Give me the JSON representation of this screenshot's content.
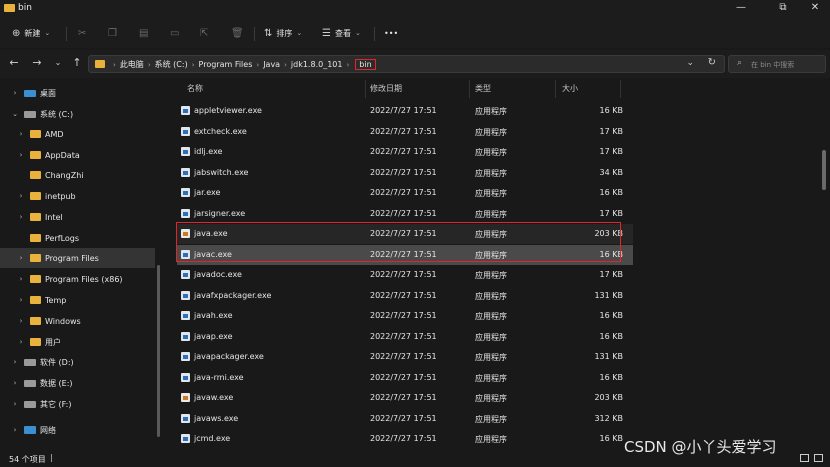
{
  "window": {
    "title": "bin"
  },
  "toolbar": {
    "new_label": "新建",
    "sort_label": "排序",
    "view_label": "查看",
    "more_label": "•••"
  },
  "address": {
    "crumbs": [
      "此电脑",
      "系统 (C:)",
      "Program Files",
      "Java",
      "jdk1.8.0_101"
    ],
    "current": "bin"
  },
  "search": {
    "placeholder": "在 bin 中搜索"
  },
  "sidebar": {
    "items": [
      {
        "label": "桌面",
        "chev": "›",
        "icon": "desktop-icon"
      },
      {
        "label": "系统 (C:)",
        "chev": "⌄",
        "icon": "drive-icon"
      },
      {
        "label": "AMD",
        "chev": "›",
        "icon": "folder-icon"
      },
      {
        "label": "AppData",
        "chev": "›",
        "icon": "folder-icon"
      },
      {
        "label": "ChangZhi",
        "chev": "",
        "icon": "folder-icon"
      },
      {
        "label": "inetpub",
        "chev": "›",
        "icon": "folder-icon"
      },
      {
        "label": "Intel",
        "chev": "›",
        "icon": "folder-icon"
      },
      {
        "label": "PerfLogs",
        "chev": "",
        "icon": "folder-icon"
      },
      {
        "label": "Program Files",
        "chev": "›",
        "icon": "folder-icon"
      },
      {
        "label": "Program Files (x86)",
        "chev": "›",
        "icon": "folder-icon"
      },
      {
        "label": "Temp",
        "chev": "›",
        "icon": "folder-icon"
      },
      {
        "label": "Windows",
        "chev": "›",
        "icon": "folder-icon"
      },
      {
        "label": "用户",
        "chev": "›",
        "icon": "folder-icon"
      },
      {
        "label": "软件 (D:)",
        "chev": "›",
        "icon": "drive-icon"
      },
      {
        "label": "数据 (E:)",
        "chev": "›",
        "icon": "drive-icon"
      },
      {
        "label": "其它 (F:)",
        "chev": "›",
        "icon": "drive-icon"
      },
      {
        "label": "网络",
        "chev": "›",
        "icon": "network-icon"
      }
    ]
  },
  "columns": {
    "name": "名称",
    "date": "修改日期",
    "type": "类型",
    "size": "大小"
  },
  "files": [
    {
      "name": "appletviewer.exe",
      "date": "2022/7/27 17:51",
      "type": "应用程序",
      "size": "16 KB"
    },
    {
      "name": "extcheck.exe",
      "date": "2022/7/27 17:51",
      "type": "应用程序",
      "size": "17 KB"
    },
    {
      "name": "idlj.exe",
      "date": "2022/7/27 17:51",
      "type": "应用程序",
      "size": "17 KB"
    },
    {
      "name": "jabswitch.exe",
      "date": "2022/7/27 17:51",
      "type": "应用程序",
      "size": "34 KB"
    },
    {
      "name": "jar.exe",
      "date": "2022/7/27 17:51",
      "type": "应用程序",
      "size": "16 KB"
    },
    {
      "name": "jarsigner.exe",
      "date": "2022/7/27 17:51",
      "type": "应用程序",
      "size": "17 KB"
    },
    {
      "name": "java.exe",
      "date": "2022/7/27 17:51",
      "type": "应用程序",
      "size": "203 KB"
    },
    {
      "name": "javac.exe",
      "date": "2022/7/27 17:51",
      "type": "应用程序",
      "size": "16 KB"
    },
    {
      "name": "javadoc.exe",
      "date": "2022/7/27 17:51",
      "type": "应用程序",
      "size": "17 KB"
    },
    {
      "name": "javafxpackager.exe",
      "date": "2022/7/27 17:51",
      "type": "应用程序",
      "size": "131 KB"
    },
    {
      "name": "javah.exe",
      "date": "2022/7/27 17:51",
      "type": "应用程序",
      "size": "16 KB"
    },
    {
      "name": "javap.exe",
      "date": "2022/7/27 17:51",
      "type": "应用程序",
      "size": "16 KB"
    },
    {
      "name": "javapackager.exe",
      "date": "2022/7/27 17:51",
      "type": "应用程序",
      "size": "131 KB"
    },
    {
      "name": "java-rmi.exe",
      "date": "2022/7/27 17:51",
      "type": "应用程序",
      "size": "16 KB"
    },
    {
      "name": "javaw.exe",
      "date": "2022/7/27 17:51",
      "type": "应用程序",
      "size": "203 KB"
    },
    {
      "name": "javaws.exe",
      "date": "2022/7/27 17:51",
      "type": "应用程序",
      "size": "312 KB"
    },
    {
      "name": "jcmd.exe",
      "date": "2022/7/27 17:51",
      "type": "应用程序",
      "size": "16 KB"
    }
  ],
  "status": {
    "count": "54 个项目"
  },
  "watermark": "CSDN @小丫头爱学习"
}
